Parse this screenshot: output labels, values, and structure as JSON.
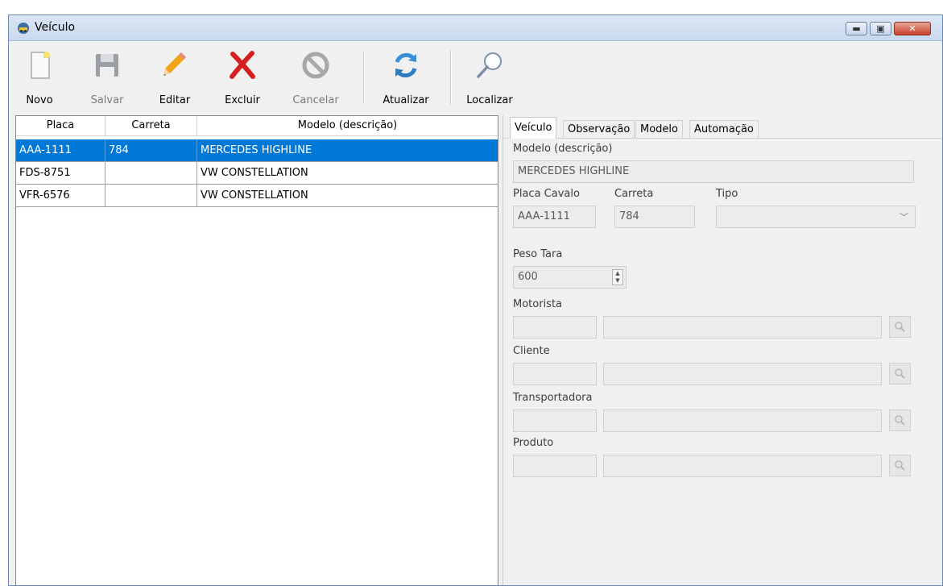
{
  "window": {
    "title": "Veículo",
    "controls": {
      "minimize": "▬",
      "maximize": "▣",
      "close": "✕"
    }
  },
  "toolbar": {
    "items": [
      {
        "label": "Novo",
        "icon": "new-document-icon",
        "enabled": true
      },
      {
        "label": "Salvar",
        "icon": "floppy-disk-icon",
        "enabled": false
      },
      {
        "label": "Editar",
        "icon": "pencil-icon",
        "enabled": true
      },
      {
        "label": "Excluir",
        "icon": "red-x-icon",
        "enabled": true
      },
      {
        "label": "Cancelar",
        "icon": "cancel-circle-icon",
        "enabled": false
      },
      {
        "label": "Atualizar",
        "icon": "refresh-icon",
        "enabled": true
      },
      {
        "label": "Localizar",
        "icon": "magnifier-icon",
        "enabled": true
      }
    ]
  },
  "grid": {
    "columns": [
      "Placa",
      "Carreta",
      "Modelo (descrição)"
    ],
    "rows": [
      {
        "placa": "AAA-1111",
        "carreta": "784",
        "modelo": "MERCEDES HIGHLINE",
        "selected": true
      },
      {
        "placa": "FDS-8751",
        "carreta": "",
        "modelo": "VW CONSTELLATION",
        "selected": false
      },
      {
        "placa": "VFR-6576",
        "carreta": "",
        "modelo": "VW CONSTELLATION",
        "selected": false
      }
    ]
  },
  "tabs": [
    "Veículo",
    "Observação",
    "Modelo",
    "Automação"
  ],
  "form": {
    "modelo_label": "Modelo (descrição)",
    "modelo_value": "MERCEDES HIGHLINE",
    "placa_label": "Placa Cavalo",
    "placa_value": "AAA-1111",
    "carreta_label": "Carreta",
    "carreta_value": "784",
    "tipo_label": "Tipo",
    "tipo_value": "",
    "peso_label": "Peso Tara",
    "peso_value": "600",
    "motorista_label": "Motorista",
    "cliente_label": "Cliente",
    "transportadora_label": "Transportadora",
    "produto_label": "Produto"
  },
  "colors": {
    "selection": "#0078d7",
    "titlebar": "#c9d9ee",
    "close_button": "#c7402a"
  }
}
